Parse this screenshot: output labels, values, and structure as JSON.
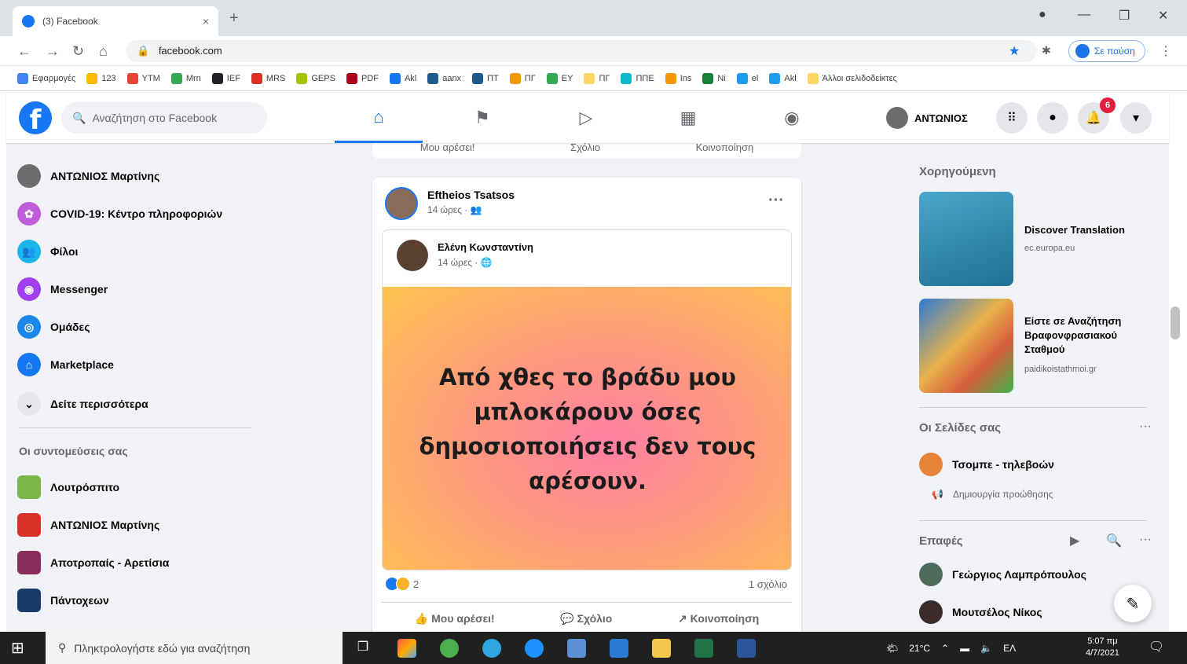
{
  "browser": {
    "tab_title": "(3) Facebook",
    "tab_close": "×",
    "new_tab": "+",
    "url": "facebook.com",
    "profile_label": "Σε παύση",
    "bookmarks": [
      {
        "label": "Εφαρμογές",
        "color": "#4285f4"
      },
      {
        "label": "123",
        "color": "#fbbc04"
      },
      {
        "label": "YTM",
        "color": "#ea4335"
      },
      {
        "label": "Mrn",
        "color": "#34a853"
      },
      {
        "label": "IEF",
        "color": "#202124"
      },
      {
        "label": "MRS",
        "color": "#d93025"
      },
      {
        "label": "GEPS",
        "color": "#a5c400"
      },
      {
        "label": "PDF",
        "color": "#b00020"
      },
      {
        "label": "Akl",
        "color": "#1877f2"
      },
      {
        "label": "aanx",
        "color": "#1e5b8a"
      },
      {
        "label": "ΠΤ",
        "color": "#1e5b8a"
      },
      {
        "label": "ΠΓ",
        "color": "#f29900"
      },
      {
        "label": "EY",
        "color": "#34a853"
      },
      {
        "label": "ΠΓ",
        "color": "#fdd663"
      },
      {
        "label": "ΠΠΕ",
        "color": "#12b5cb"
      },
      {
        "label": "Ins",
        "color": "#f29900"
      },
      {
        "label": "Ni",
        "color": "#188038"
      },
      {
        "label": "el",
        "color": "#1d9bf0"
      },
      {
        "label": "Akl",
        "color": "#1d9bf0"
      },
      {
        "label": "Άλλοι σελιδοδείκτες",
        "color": "#fdd663"
      }
    ]
  },
  "fb": {
    "logo": "f",
    "search_placeholder": "Αναζήτηση στο Facebook",
    "user_name": "ΑΝΤΩΝΙΟΣ",
    "notif_count": "6"
  },
  "left": {
    "items": [
      {
        "label": "ΑΝΤΩΝΙΟΣ Μαρτίνης",
        "color": "#6d6d6d",
        "glyph": ""
      },
      {
        "label": "COVID-19: Κέντρο πληροφοριών",
        "color": "#c05eda",
        "glyph": "✿"
      },
      {
        "label": "Φίλοι",
        "color": "#1bb6e8",
        "glyph": "👥"
      },
      {
        "label": "Messenger",
        "color": "#a040f0",
        "glyph": "◉"
      },
      {
        "label": "Ομάδες",
        "color": "#1b87e8",
        "glyph": "◎"
      },
      {
        "label": "Marketplace",
        "color": "#1877f2",
        "glyph": "⌂"
      },
      {
        "label": "Δείτε περισσότερα",
        "color": "#e4e6eb",
        "glyph": "⌄"
      }
    ],
    "shortcuts_title": "Οι συντομεύσεις σας",
    "shortcuts": [
      {
        "label": "Λουτρόσπιτο",
        "color": "#7ab648"
      },
      {
        "label": "ΑΝΤΩΝΙΟΣ Μαρτίνης",
        "color": "#d93025"
      },
      {
        "label": "Αποτροπαίς - Αρετίσια",
        "color": "#8b2d5a"
      },
      {
        "label": "Πάντοχεων",
        "color": "#1a3a6a"
      }
    ]
  },
  "composer": {
    "like": "Μου αρέσει!",
    "comment": "Σχόλιο",
    "share": "Κοινοποίηση"
  },
  "post": {
    "author": "Eftheios Tsatsos",
    "time": "14 ώρες · 👥",
    "more": "···",
    "shared_author": "Ελένη Κωνσταντίνη",
    "shared_time": "14 ώρες · 🌐",
    "text": "Από χθες το βράδυ μου μπλοκάρουν όσες δημοσιοποιήσεις δεν τους αρέσουν.",
    "reaction_count": "2",
    "comments": "1 σχόλιο",
    "like": "Μου αρέσει!",
    "comment": "Σχόλιο",
    "share": "Κοινοποίηση"
  },
  "right": {
    "sponsored_title": "Χορηγούμενη",
    "ads": [
      {
        "title": "Discover Translation",
        "url": "ec.europa.eu"
      },
      {
        "title": "Είστε σε Αναζήτηση Βραφονφρασιακού Σταθμού",
        "url": "paidikoistathmoi.gr"
      }
    ],
    "pages_title": "Οι Σελίδες σας",
    "pages_more": "···",
    "page_name": "Τσομπε - τηλεβοών",
    "create_promo": "Δημιουργία προώθησης",
    "contacts_title": "Επαφές",
    "contacts": [
      {
        "name": "Γεώργιος Λαμπρόπουλος"
      },
      {
        "name": "Μουτσέλος Νίκος"
      }
    ]
  },
  "taskbar": {
    "search_placeholder": "Πληκτρολογήστε εδώ για αναζήτηση",
    "weather": "21°C",
    "lang": "ΕΛ",
    "time": "5:07 πμ",
    "date": "4/7/2021"
  }
}
